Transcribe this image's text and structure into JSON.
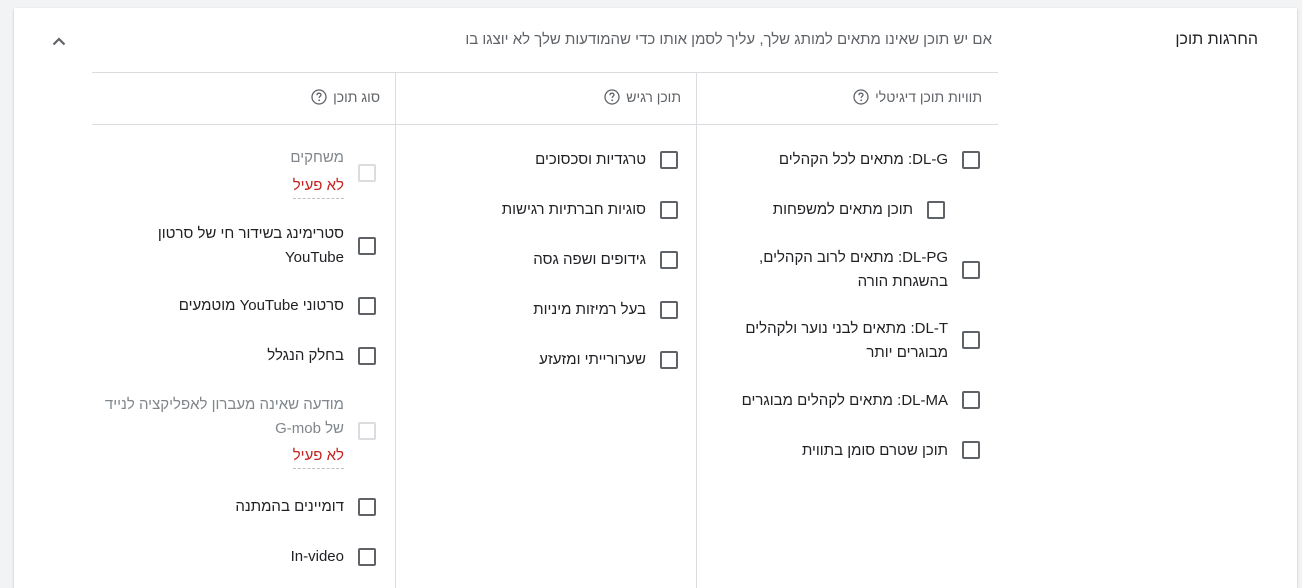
{
  "section": {
    "title": "החרגות תוכן",
    "description": "אם יש תוכן שאינו מתאים למותג שלך, עליך לסמן אותו כדי שהמודעות שלך לא יוצגו בו"
  },
  "columns": {
    "digital_labels": {
      "header": "תוויות תוכן דיגיטלי",
      "items": [
        {
          "label": "DL-G: מתאים לכל הקהלים"
        },
        {
          "label": "תוכן מתאים למשפחות"
        },
        {
          "label": "DL-PG: מתאים לרוב הקהלים, בהשגחת הורה"
        },
        {
          "label": "DL-T: מתאים לבני נוער ולקהלים מבוגרים יותר"
        },
        {
          "label": "DL-MA: מתאים לקהלים מבוגרים"
        },
        {
          "label": "תוכן שטרם סומן בתווית"
        }
      ]
    },
    "sensitive": {
      "header": "תוכן רגיש",
      "items": [
        {
          "label": "טרגדיות וסכסוכים"
        },
        {
          "label": "סוגיות חברתיות רגישות"
        },
        {
          "label": "גידופים ושפה גסה"
        },
        {
          "label": "בעל רמיזות מיניות"
        },
        {
          "label": "שערורייתי ומזעזע"
        }
      ]
    },
    "content_type": {
      "header": "סוג תוכן",
      "items": [
        {
          "label": "משחקים",
          "status": "לא פעיל"
        },
        {
          "label": "סטרימינג בשידור חי של סרטון YouTube"
        },
        {
          "label": "סרטוני YouTube מוטמעים"
        },
        {
          "label": "בחלק הנגלל"
        },
        {
          "label": "מודעה שאינה מעברון לאפליקציה לנייד של G-mob",
          "status": "לא פעיל"
        },
        {
          "label": "דומיינים בהמתנה"
        },
        {
          "label": "In-video"
        }
      ]
    }
  },
  "icons": {
    "collapse": "chevron-up-icon",
    "help": "help-circle-icon"
  },
  "colors": {
    "inactive_text": "#c5221f",
    "border": "#dadce0",
    "checkbox_border": "#5f6368"
  }
}
